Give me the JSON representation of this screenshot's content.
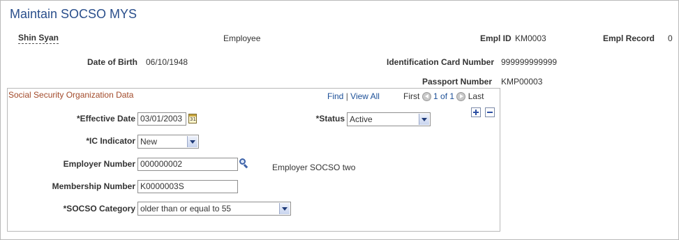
{
  "page": {
    "title": "Maintain SOCSO MYS"
  },
  "header": {
    "employee_name": "Shin Syan",
    "employee_type": "Employee",
    "empl_id_label": "Empl ID",
    "empl_id_value": "KM0003",
    "empl_record_label": "Empl Record",
    "empl_record_value": "0",
    "dob_label": "Date of Birth",
    "dob_value": "06/10/1948",
    "ic_label": "Identification Card Number",
    "ic_value": "999999999999",
    "passport_label": "Passport Number",
    "passport_value": "KMP00003"
  },
  "group": {
    "title": "Social Security Organization Data",
    "nav": {
      "find": "Find",
      "separator": "|",
      "view_all": "View All",
      "first": "First",
      "range": "1 of 1",
      "last": "Last"
    },
    "add_icon": "plus-icon",
    "delete_icon": "minus-icon"
  },
  "form": {
    "effective_date_label": "*Effective Date",
    "effective_date_value": "03/01/2003",
    "calendar_icon_text": "31",
    "status_label": "*Status",
    "status_value": "Active",
    "ic_indicator_label": "*IC Indicator",
    "ic_indicator_value": "New",
    "employer_number_label": "Employer Number",
    "employer_number_value": "000000002",
    "employer_description": "Employer SOCSO two",
    "membership_number_label": "Membership Number",
    "membership_number_value": "K0000003S",
    "socso_category_label": "*SOCSO Category",
    "socso_category_value": "older than or equal to 55"
  },
  "colors": {
    "title": "#2a4f8c",
    "group_title": "#a24a2a",
    "link": "#1c4f97",
    "border": "#b9b9b9"
  }
}
